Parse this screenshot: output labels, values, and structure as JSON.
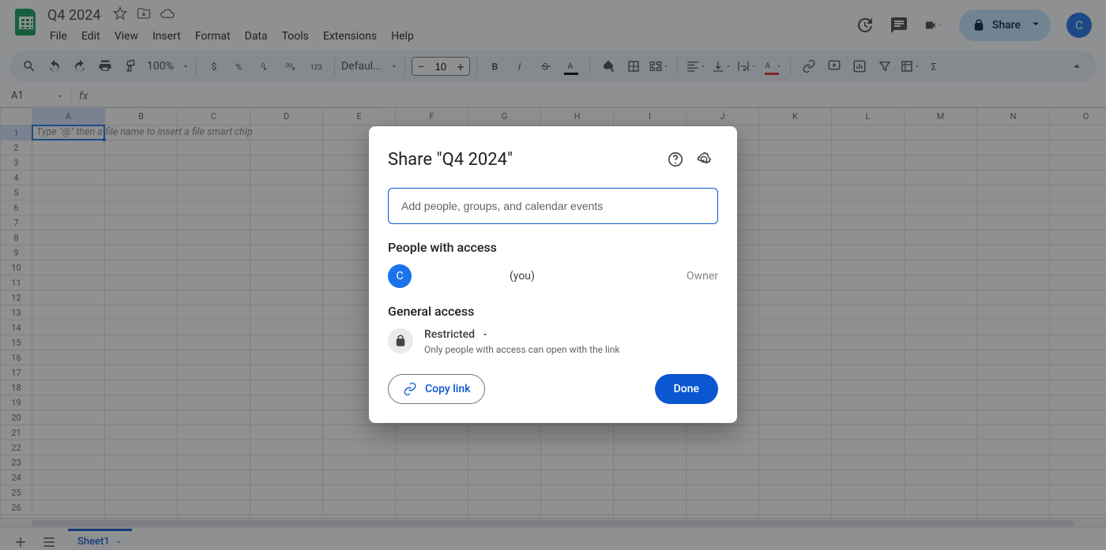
{
  "doc": {
    "name": "Q4 2024"
  },
  "menus": [
    "File",
    "Edit",
    "View",
    "Insert",
    "Format",
    "Data",
    "Tools",
    "Extensions",
    "Help"
  ],
  "toolbar": {
    "zoom": "100%",
    "font": "Defaul...",
    "font_size": "10",
    "share_label": "Share",
    "avatar_letter": "C"
  },
  "namebox": "A1",
  "columns": [
    "A",
    "B",
    "C",
    "D",
    "E",
    "F",
    "G",
    "H",
    "I",
    "J",
    "K",
    "L",
    "M",
    "N",
    "O"
  ],
  "rows": 27,
  "cell_hint": "Type \"@\" then a file name to insert a file smart chip",
  "sheet_tab": "Sheet1",
  "dialog": {
    "title": "Share \"Q4 2024\"",
    "placeholder": "Add people, groups, and calendar events",
    "access_heading": "People with access",
    "you_suffix": "(you)",
    "avatar_letter": "C",
    "role": "Owner",
    "general_heading": "General access",
    "restricted": "Restricted",
    "restricted_desc": "Only people with access can open with the link",
    "copy_link": "Copy link",
    "done": "Done"
  }
}
